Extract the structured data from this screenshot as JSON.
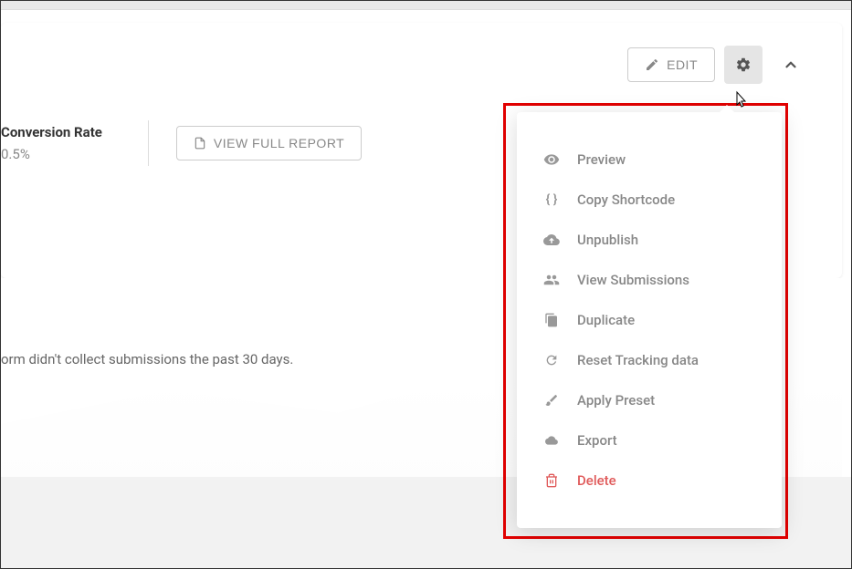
{
  "toolbar": {
    "edit_label": "EDIT",
    "view_report_label": "VIEW FULL REPORT"
  },
  "stats": {
    "conversion_rate_label": "Conversion Rate",
    "conversion_rate_value": "0.5%"
  },
  "info": {
    "no_submissions_text": "orm didn't collect submissions the past 30 days."
  },
  "dropdown": {
    "items": [
      {
        "label": "Preview",
        "icon": "eye-icon"
      },
      {
        "label": "Copy Shortcode",
        "icon": "braces-icon"
      },
      {
        "label": "Unpublish",
        "icon": "cloud-icon"
      },
      {
        "label": "View Submissions",
        "icon": "people-icon"
      },
      {
        "label": "Duplicate",
        "icon": "copy-icon"
      },
      {
        "label": "Reset Tracking data",
        "icon": "refresh-icon"
      },
      {
        "label": "Apply Preset",
        "icon": "brush-icon"
      },
      {
        "label": "Export",
        "icon": "export-cloud-icon"
      },
      {
        "label": "Delete",
        "icon": "trash-icon",
        "danger": true
      }
    ]
  }
}
